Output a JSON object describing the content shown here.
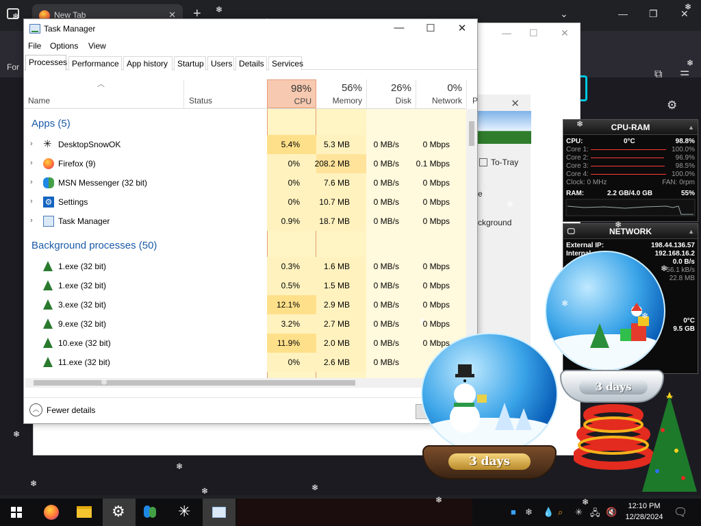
{
  "browser": {
    "tab_title": "New Tab",
    "for_text": "For"
  },
  "task_manager": {
    "title": "Task Manager",
    "menu": [
      "File",
      "Options",
      "View"
    ],
    "tabs": [
      "Processes",
      "Performance",
      "App history",
      "Startup",
      "Users",
      "Details",
      "Services"
    ],
    "active_tab": "Processes",
    "columns": {
      "name": "Name",
      "status": "Status",
      "cpu": {
        "pct": "98%",
        "label": "CPU"
      },
      "memory": {
        "pct": "56%",
        "label": "Memory"
      },
      "disk": {
        "pct": "26%",
        "label": "Disk"
      },
      "network": {
        "pct": "0%",
        "label": "Network"
      },
      "extra": "P"
    },
    "apps_group": "Apps (5)",
    "apps": [
      {
        "name": "DesktopSnowOK",
        "cpu": "5.4%",
        "memory": "5.3 MB",
        "disk": "0 MB/s",
        "network": "0 Mbps",
        "icon": "snowflake-icon"
      },
      {
        "name": "Firefox (9)",
        "cpu": "0%",
        "memory": "208.2 MB",
        "disk": "0 MB/s",
        "network": "0.1 Mbps",
        "icon": "firefox-icon"
      },
      {
        "name": "MSN Messenger (32 bit)",
        "cpu": "0%",
        "memory": "7.6 MB",
        "disk": "0 MB/s",
        "network": "0 Mbps",
        "icon": "messenger-icon"
      },
      {
        "name": "Settings",
        "cpu": "0%",
        "memory": "10.7 MB",
        "disk": "0 MB/s",
        "network": "0 Mbps",
        "icon": "gear-icon"
      },
      {
        "name": "Task Manager",
        "cpu": "0.9%",
        "memory": "18.7 MB",
        "disk": "0 MB/s",
        "network": "0 Mbps",
        "icon": "task-manager-icon"
      }
    ],
    "bg_group": "Background processes (50)",
    "background": [
      {
        "name": "1.exe (32 bit)",
        "cpu": "0.3%",
        "memory": "1.6 MB",
        "disk": "0 MB/s",
        "network": "0 Mbps",
        "icon": "tree-icon"
      },
      {
        "name": "1.exe (32 bit)",
        "cpu": "0.5%",
        "memory": "1.5 MB",
        "disk": "0 MB/s",
        "network": "0 Mbps",
        "icon": "tree-icon"
      },
      {
        "name": "3.exe (32 bit)",
        "cpu": "12.1%",
        "memory": "2.9 MB",
        "disk": "0 MB/s",
        "network": "0 Mbps",
        "icon": "tree-icon"
      },
      {
        "name": "9.exe (32 bit)",
        "cpu": "3.2%",
        "memory": "2.7 MB",
        "disk": "0 MB/s",
        "network": "0 Mbps",
        "icon": "tree-icon"
      },
      {
        "name": "10.exe (32 bit)",
        "cpu": "11.9%",
        "memory": "2.0 MB",
        "disk": "0 MB/s",
        "network": "0 Mbps",
        "icon": "tree-icon"
      },
      {
        "name": "11.exe (32 bit)",
        "cpu": "0%",
        "memory": "2.6 MB",
        "disk": "0 MB/s",
        "network": "",
        "icon": "tree-icon"
      }
    ],
    "fewer_details": "Fewer details"
  },
  "dialog": {
    "to_tray": "To-Tray",
    "text1": "e",
    "text2": "ckground"
  },
  "cpu_ram": {
    "title": "CPU-RAM",
    "cpu_label": "CPU:",
    "temp": "0°C",
    "cpu_total": "98.8%",
    "cores": [
      {
        "label": "Core 1:",
        "value": "100.0%"
      },
      {
        "label": "Core 2:",
        "value": "96.9%"
      },
      {
        "label": "Core 3:",
        "value": "98.5%"
      },
      {
        "label": "Core 4:",
        "value": "100.0%"
      }
    ],
    "clock": "Clock: 0 MHz",
    "fan": "FAN: 0rpm",
    "ram_label": "RAM:",
    "ram_value": "2.2 GB/4.0 GB",
    "ram_pct": "55%"
  },
  "network": {
    "title": "NETWORK",
    "external_label": "External IP:",
    "external_ip": "198.44.136.57",
    "internal_label": "Internal",
    "internal_ip": "192.168.16.2",
    "rate1": "0.0 B/s",
    "rate2": "56.1 kB/s",
    "rate3": "22.8 MB",
    "temp": "0°C",
    "size": "9.5 GB"
  },
  "globes": {
    "days_label_1": "3 days",
    "days_label_2": "3 days"
  },
  "taskbar": {
    "time": "12:10 PM",
    "date": "12/28/2024"
  },
  "colors": {
    "accent_blue": "#1a5aa8",
    "cpu_header": "#f7c9b0",
    "cpu_high": "#ffd780",
    "cell_light": "#fff4c4"
  }
}
